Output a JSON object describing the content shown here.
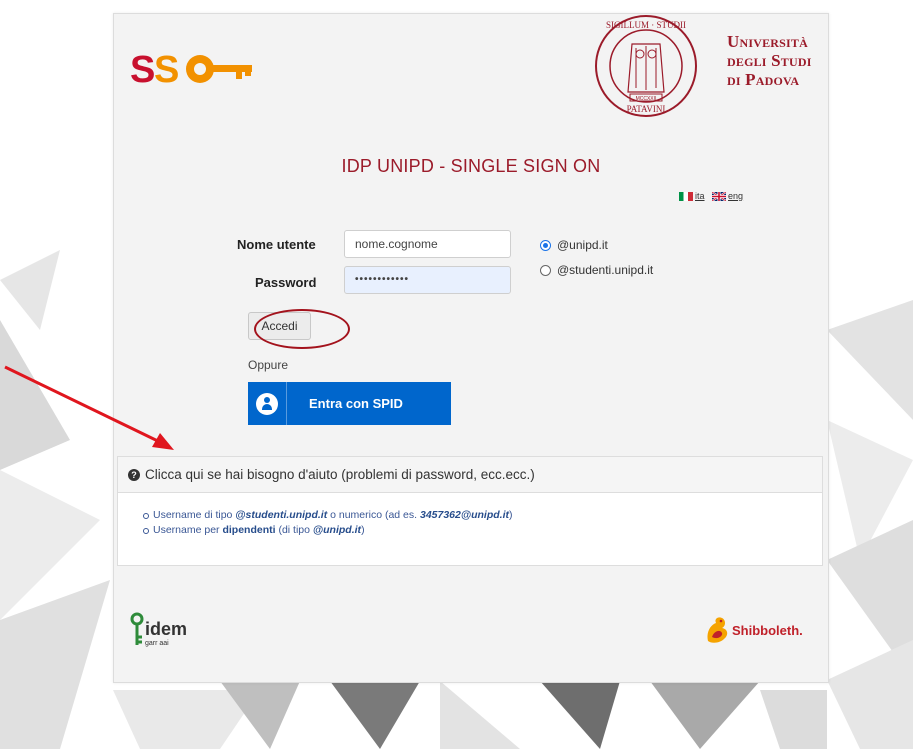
{
  "header": {
    "sso_logo_text": "SSO",
    "university": {
      "line1": "Università",
      "line2": "degli Studi",
      "line3": "di Padova"
    },
    "seal_text": "SIGILLUM STUDII PATAVINI",
    "seal_year": "MCCXXII"
  },
  "title": "IDP UNIPD - SINGLE SIGN ON",
  "languages": [
    {
      "code": "ita",
      "flag": "italy-flag"
    },
    {
      "code": "eng",
      "flag": "uk-flag"
    }
  ],
  "form": {
    "username_label": "Nome utente",
    "username_value": "nome.cognome",
    "password_label": "Password",
    "password_value": "••••••••••••",
    "domain_options": [
      {
        "label": "@unipd.it",
        "selected": true
      },
      {
        "label": "@studenti.unipd.it",
        "selected": false
      }
    ],
    "submit_label": "Accedi",
    "or_label": "Oppure",
    "spid_label": "Entra con SPID"
  },
  "help": {
    "header": "Clicca qui se hai bisogno d'aiuto (problemi di password, ecc.ecc.)",
    "items": [
      {
        "prefix": "Username di tipo ",
        "bold1": "@studenti.unipd.it",
        "middle": " o numerico (ad es. ",
        "bold2": "3457362@unipd.it",
        "suffix": ")"
      },
      {
        "prefix": "Username per ",
        "bold1": "dipendenti",
        "middle": " (di tipo ",
        "bold2": "@unipd.it",
        "suffix": ")"
      }
    ]
  },
  "footer": {
    "idem_text": "idem",
    "idem_sub": "garr aai",
    "shibboleth_text": "Shibboleth."
  },
  "colors": {
    "brand_red": "#9b1b2a",
    "spid_blue": "#0066cc",
    "annotation_red": "#e0161e"
  }
}
